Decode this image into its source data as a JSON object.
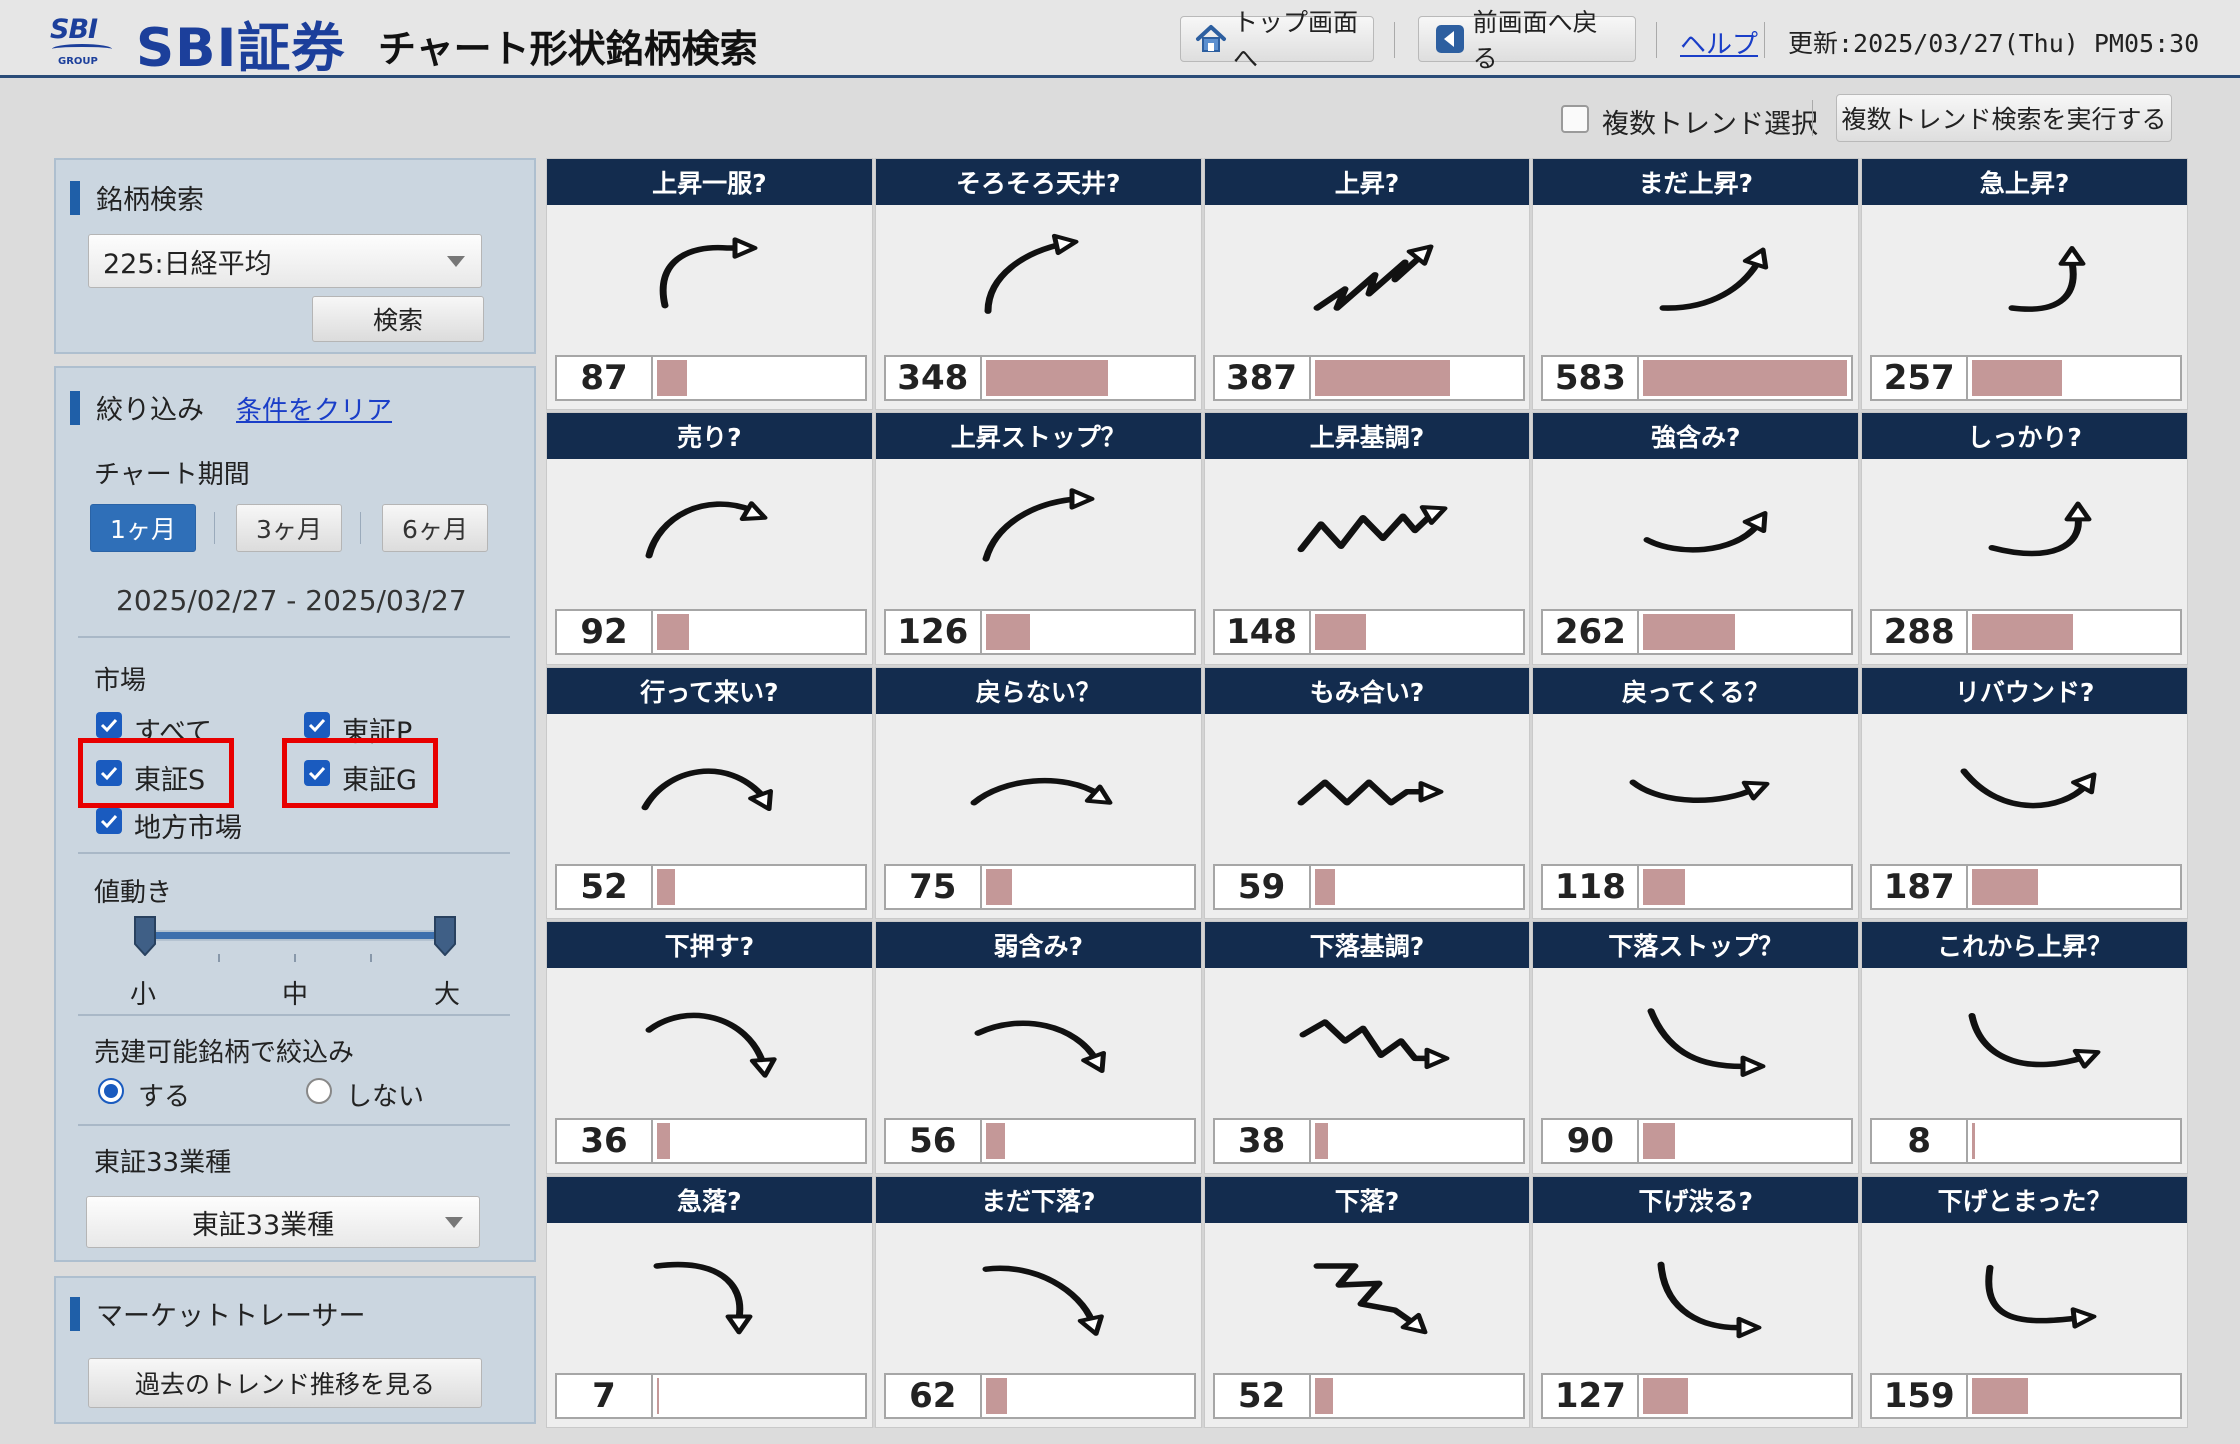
{
  "header": {
    "logo_sbi": "SBI",
    "logo_group": "GROUP",
    "brand": "SBI証券",
    "title": "チャート形状銘柄検索",
    "btn_top": "トップ画面へ",
    "btn_back": "前画面へ戻る",
    "help": "ヘルプ",
    "updated": "更新:2025/03/27(Thu) PM05:30"
  },
  "multi": {
    "label": "複数トレンド選択",
    "checked": false,
    "run_button": "複数トレンド検索を実行する"
  },
  "search": {
    "title": "銘柄検索",
    "index_value": "225:日経平均",
    "button": "検索"
  },
  "filter": {
    "title": "絞り込み",
    "clear": "条件をクリア",
    "period_label": "チャート期間",
    "periods": [
      "1ヶ月",
      "3ヶ月",
      "6ヶ月"
    ],
    "active_period": 0,
    "date_range": "2025/02/27 - 2025/03/27",
    "market_label": "市場",
    "markets": [
      {
        "label": "すべて",
        "checked": true
      },
      {
        "label": "東証P",
        "checked": true
      },
      {
        "label": "東証S",
        "checked": true
      },
      {
        "label": "東証G",
        "checked": true
      },
      {
        "label": "地方市場",
        "checked": true
      }
    ],
    "price_move_label": "値動き",
    "price_move_min": "小",
    "price_move_mid": "中",
    "price_move_max": "大",
    "price_move_range": [
      0,
      1
    ],
    "shortable_label": "売建可能銘柄で絞込み",
    "shortable_yes": "する",
    "shortable_no": "しない",
    "shortable_selected": "yes",
    "industry_label": "東証33業種",
    "industry_value": "東証33業種"
  },
  "tracer": {
    "title": "マーケットトレーサー",
    "button": "過去のトレンド推移を見る"
  },
  "colors": {
    "header_blue": "#132c4e",
    "accent_blue": "#1f5fa8",
    "count_bar": "#c49898",
    "highlight_red": "#e80000"
  },
  "patterns": [
    {
      "label": "上昇一服?",
      "count": 87,
      "icon": "rise-then-flat-arrow-icon"
    },
    {
      "label": "そろそろ天井?",
      "count": 348,
      "icon": "rise-to-ceiling-arrow-icon"
    },
    {
      "label": "上昇?",
      "count": 387,
      "icon": "zigzag-up-arrow-icon"
    },
    {
      "label": "まだ上昇?",
      "count": 583,
      "icon": "curve-up-arrow-icon"
    },
    {
      "label": "急上昇?",
      "count": 257,
      "icon": "sharp-rise-arrow-icon"
    },
    {
      "label": "売り?",
      "count": 92,
      "icon": "rise-then-turn-arrow-icon"
    },
    {
      "label": "上昇ストップ？",
      "count": 126,
      "icon": "rise-stop-arrow-icon"
    },
    {
      "label": "上昇基調?",
      "count": 148,
      "icon": "zigzag-uptrend-arrow-icon"
    },
    {
      "label": "強含み?",
      "count": 262,
      "icon": "bowl-up-arrow-icon"
    },
    {
      "label": "しっかり?",
      "count": 288,
      "icon": "bowl-sharp-up-arrow-icon"
    },
    {
      "label": "行って来い?",
      "count": 52,
      "icon": "arch-down-arrow-icon"
    },
    {
      "label": "戻らない？",
      "count": 75,
      "icon": "flat-arch-down-arrow-icon"
    },
    {
      "label": "もみ合い?",
      "count": 59,
      "icon": "sideways-zigzag-arrow-icon"
    },
    {
      "label": "戻ってくる？",
      "count": 118,
      "icon": "shallow-bowl-arrow-icon"
    },
    {
      "label": "リバウンド?",
      "count": 187,
      "icon": "v-rebound-arrow-icon"
    },
    {
      "label": "下押す?",
      "count": 36,
      "icon": "arch-drop-arrow-icon"
    },
    {
      "label": "弱含み?",
      "count": 56,
      "icon": "weak-drop-arrow-icon"
    },
    {
      "label": "下落基調?",
      "count": 38,
      "icon": "zigzag-downtrend-arrow-icon"
    },
    {
      "label": "下落ストップ？",
      "count": 90,
      "icon": "fall-stop-arrow-icon"
    },
    {
      "label": "これから上昇？",
      "count": 8,
      "icon": "fall-then-rise-arrow-icon"
    },
    {
      "label": "急落?",
      "count": 7,
      "icon": "sharp-drop-arrow-icon"
    },
    {
      "label": "まだ下落?",
      "count": 62,
      "icon": "still-falling-arrow-icon"
    },
    {
      "label": "下落?",
      "count": 52,
      "icon": "zigzag-down-arrow-icon"
    },
    {
      "label": "下げ渋る?",
      "count": 127,
      "icon": "fall-slowing-arrow-icon"
    },
    {
      "label": "下げとまった？",
      "count": 159,
      "icon": "fall-stopped-arrow-icon"
    }
  ]
}
